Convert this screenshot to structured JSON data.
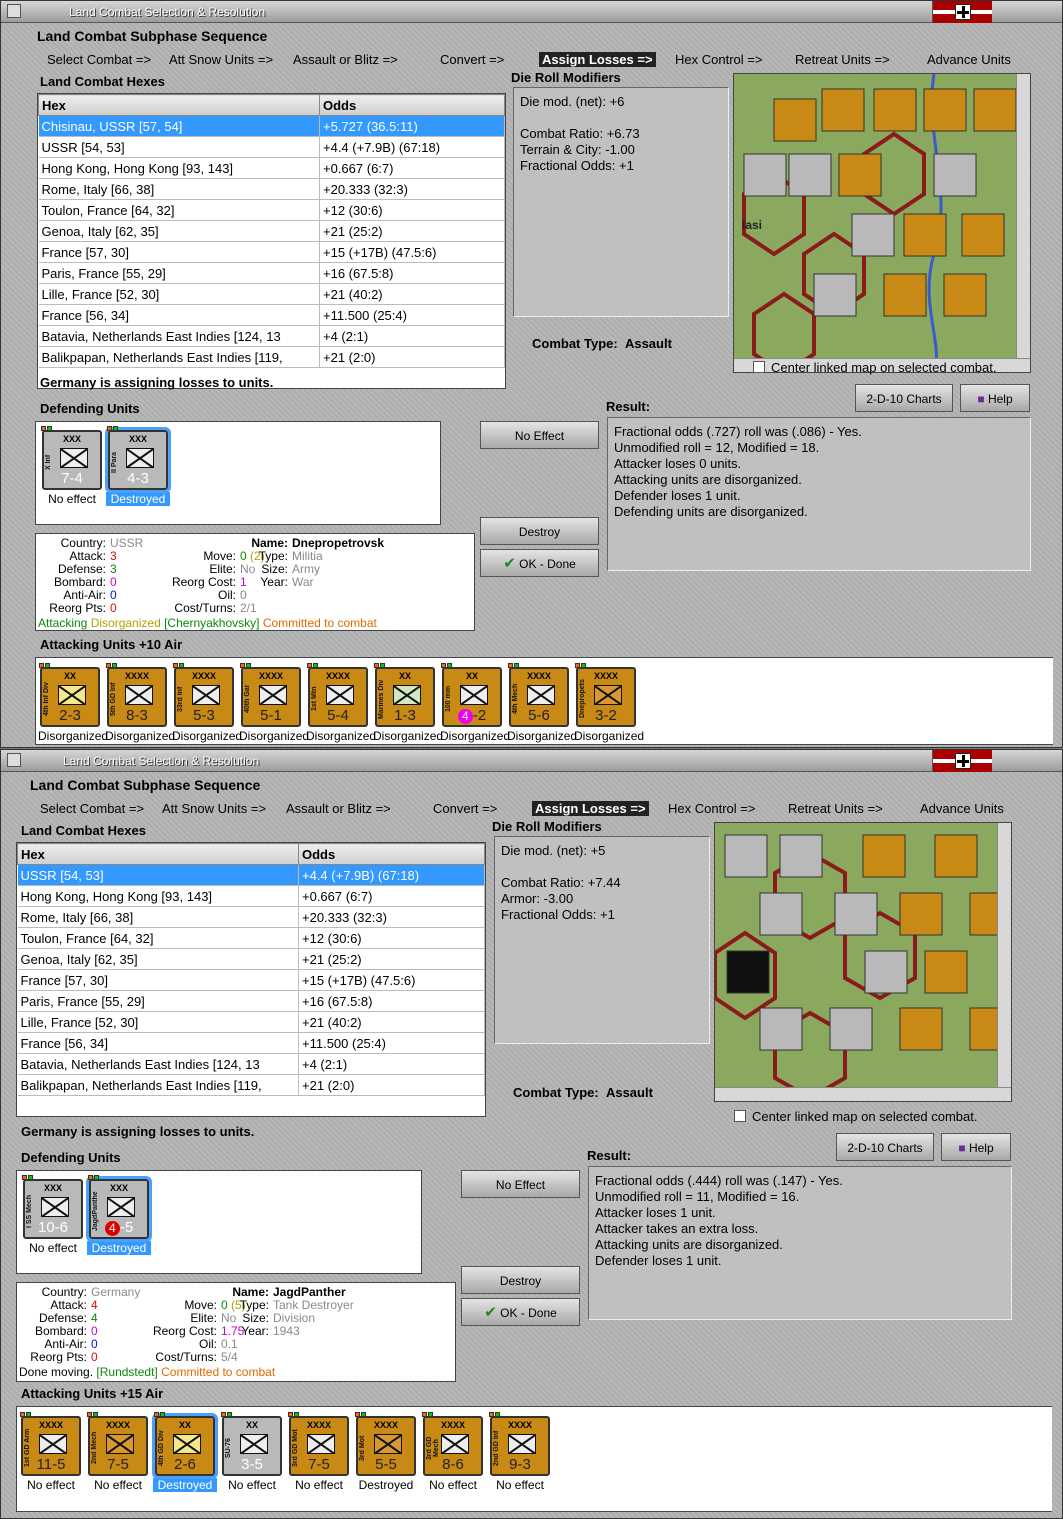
{
  "windows": [
    {
      "title": "Land Combat Selection & Resolution",
      "subphase_title": "Land Combat Subphase Sequence",
      "sequence": [
        "Select Combat =>",
        "Att Snow Units =>",
        "Assault or Blitz =>",
        "Convert =>",
        "Assign Losses =>",
        "Hex Control =>",
        "Retreat Units =>",
        "Advance Units"
      ],
      "hexes_label": "Land Combat Hexes",
      "col_hex": "Hex",
      "col_odds": "Odds",
      "rows": [
        {
          "hex": "Chisinau, USSR [57, 54]",
          "odds": "+5.727 (36.5:11)"
        },
        {
          "hex": "USSR [54, 53]",
          "odds": "+4.4 (+7.9B) (67:18)"
        },
        {
          "hex": "Hong Kong, Hong Kong [93, 143]",
          "odds": "+0.667 (6:7)"
        },
        {
          "hex": "Rome, Italy [66, 38]",
          "odds": "+20.333 (32:3)"
        },
        {
          "hex": "Toulon, France [64, 32]",
          "odds": "+12 (30:6)"
        },
        {
          "hex": "Genoa, Italy [62, 35]",
          "odds": "+21 (25:2)"
        },
        {
          "hex": "France [57, 30]",
          "odds": "+15 (+17B) (47.5:6)"
        },
        {
          "hex": "Paris, France [55, 29]",
          "odds": "+16 (67.5:8)"
        },
        {
          "hex": "Lille, France [52, 30]",
          "odds": "+21 (40:2)"
        },
        {
          "hex": "France [56, 34]",
          "odds": "+11.500 (25:4)"
        },
        {
          "hex": "Batavia, Netherlands East Indies [124, 13",
          "odds": "+4 (2:1)"
        },
        {
          "hex": "Balikpapan, Netherlands East Indies [119,",
          "odds": "+21 (2:0)"
        }
      ],
      "drm_label": "Die Roll Modifiers",
      "drm_lines": [
        "Die mod. (net): +6",
        "",
        "Combat Ratio: +6.73",
        "Terrain & City: -1.00",
        "Fractional Odds: +1"
      ],
      "combat_type_label": "Combat Type:",
      "combat_type": "Assault",
      "center_map": "Center linked map on selected combat.",
      "charts_btn": "2-D-10 Charts",
      "help_btn": "Help",
      "status": "Germany is assigning losses to units.",
      "defending_label": "Defending Units",
      "no_effect_btn": "No Effect",
      "destroy_btn": "Destroy",
      "ok_btn": "OK - Done",
      "result_label": "Result:",
      "result_lines": [
        "Fractional odds (.727) roll was (.086)  - Yes.",
        "Unmodified roll = 12, Modified = 18.",
        "Attacker loses 0 units.",
        "Attacking units are disorganized.",
        "Defender loses 1 unit.",
        "Defending units are disorganized."
      ],
      "defenders": [
        {
          "side": "X Inf",
          "ech": "XXX",
          "str": "7-4",
          "label": "No effect",
          "sel": false
        },
        {
          "side": "II Para",
          "ech": "XXX",
          "str": "4-3",
          "label": "Destroyed",
          "sel": true
        }
      ],
      "info": {
        "country_k": "Country:",
        "country_v": "USSR",
        "attack_k": "Attack:",
        "attack_v": "3",
        "defense_k": "Defense:",
        "defense_v": "3",
        "bombard_k": "Bombard:",
        "bombard_v": "0",
        "antiair_k": "Anti-Air:",
        "antiair_v": "0",
        "reorgpts_k": "Reorg Pts:",
        "reorgpts_v": "0",
        "move_k": "Move:",
        "move_v": "0",
        "move_v2": "(2)",
        "elite_k": "Elite:",
        "elite_v": "No",
        "reorgcost_k": "Reorg Cost:",
        "reorgcost_v": "1",
        "oil_k": "Oil:",
        "oil_v": "0",
        "cost_k": "Cost/Turns:",
        "cost_v": "2/1",
        "name_k": "Name:",
        "name_v": "Dnepropetrovsk",
        "type_k": "Type:",
        "type_v": "Militia",
        "size_k": "Size:",
        "size_v": "Army",
        "year_k": "Year:",
        "year_v": "War",
        "foot_a": "Attacking",
        "foot_b": "Disorganized",
        "foot_c": "[Chernyakhovsky]",
        "foot_d": "Committed to combat"
      },
      "attacking_label": "Attacking Units +10 Air",
      "attackers": [
        {
          "side": "4th Inf Div",
          "ech": "XX",
          "str": "2-3",
          "label": "Disorganized",
          "sym": "yel"
        },
        {
          "side": "5th GD Inf",
          "ech": "XXXX",
          "str": "8-3",
          "label": "Disorganized",
          "sym": ""
        },
        {
          "side": "33rd Inf",
          "ech": "XXXX",
          "str": "5-3",
          "label": "Disorganized",
          "sym": ""
        },
        {
          "side": "40th Gar",
          "ech": "XXXX",
          "str": "5-1",
          "label": "Disorganized",
          "sym": ""
        },
        {
          "side": "1st Mtn",
          "ech": "XXXX",
          "str": "5-4",
          "label": "Disorganized",
          "sym": ""
        },
        {
          "side": "Marines Div",
          "ech": "XX",
          "str": "1-3",
          "label": "Disorganized",
          "sym": "grn"
        },
        {
          "side": "100 mm",
          "ech": "XX",
          "str": "4",
          "str2": "-2",
          "label": "Disorganized",
          "sym": "",
          "badge": "m"
        },
        {
          "side": "4th Mech",
          "ech": "XXXX",
          "str": "5-6",
          "label": "Disorganized",
          "sym": ""
        },
        {
          "side": "Dnepropets",
          "ech": "XXXX",
          "str": "3-2",
          "label": "Disorganized",
          "sym": "gold2"
        }
      ]
    },
    {
      "title": "Land Combat Selection & Resolution",
      "subphase_title": "Land Combat Subphase Sequence",
      "sequence": [
        "Select Combat =>",
        "Att Snow Units =>",
        "Assault or Blitz =>",
        "Convert =>",
        "Assign Losses =>",
        "Hex Control =>",
        "Retreat Units =>",
        "Advance Units"
      ],
      "hexes_label": "Land Combat Hexes",
      "col_hex": "Hex",
      "col_odds": "Odds",
      "rows": [
        {
          "hex": "USSR [54, 53]",
          "odds": "+4.4 (+7.9B) (67:18)"
        },
        {
          "hex": "Hong Kong, Hong Kong [93, 143]",
          "odds": "+0.667 (6:7)"
        },
        {
          "hex": "Rome, Italy [66, 38]",
          "odds": "+20.333 (32:3)"
        },
        {
          "hex": "Toulon, France [64, 32]",
          "odds": "+12 (30:6)"
        },
        {
          "hex": "Genoa, Italy [62, 35]",
          "odds": "+21 (25:2)"
        },
        {
          "hex": "France [57, 30]",
          "odds": "+15 (+17B) (47.5:6)"
        },
        {
          "hex": "Paris, France [55, 29]",
          "odds": "+16 (67.5:8)"
        },
        {
          "hex": "Lille, France [52, 30]",
          "odds": "+21 (40:2)"
        },
        {
          "hex": "France [56, 34]",
          "odds": "+11.500 (25:4)"
        },
        {
          "hex": "Batavia, Netherlands East Indies [124, 13",
          "odds": "+4 (2:1)"
        },
        {
          "hex": "Balikpapan, Netherlands East Indies [119,",
          "odds": "+21 (2:0)"
        }
      ],
      "drm_label": "Die Roll Modifiers",
      "drm_lines": [
        "Die mod. (net): +5",
        "",
        "Combat Ratio: +7.44",
        "Armor: -3.00",
        "Fractional Odds: +1"
      ],
      "combat_type_label": "Combat Type:",
      "combat_type": "Assault",
      "center_map": "Center linked map on selected combat.",
      "charts_btn": "2-D-10 Charts",
      "help_btn": "Help",
      "status": "Germany is assigning losses to units.",
      "defending_label": "Defending Units",
      "no_effect_btn": "No Effect",
      "destroy_btn": "Destroy",
      "ok_btn": "OK - Done",
      "result_label": "Result:",
      "result_lines": [
        "Fractional odds (.444) roll was (.147)  - Yes.",
        "Unmodified roll = 11, Modified = 16.",
        "Attacker loses 1 unit.",
        "Attacker takes an extra loss.",
        "Attacking units are disorganized.",
        "Defender loses 1 unit."
      ],
      "defenders": [
        {
          "side": "I SS Mech",
          "ech": "XXX",
          "str": "10-6",
          "label": "No effect",
          "sel": false
        },
        {
          "side": "JagdPanther",
          "ech": "XXX",
          "str": "4",
          "str2": "-5",
          "label": "Destroyed",
          "sel": true,
          "badge": "r"
        }
      ],
      "info": {
        "country_k": "Country:",
        "country_v": "Germany",
        "attack_k": "Attack:",
        "attack_v": "4",
        "defense_k": "Defense:",
        "defense_v": "4",
        "bombard_k": "Bombard:",
        "bombard_v": "0",
        "antiair_k": "Anti-Air:",
        "antiair_v": "0",
        "reorgpts_k": "Reorg Pts:",
        "reorgpts_v": "0",
        "move_k": "Move:",
        "move_v": "0",
        "move_v2": "(5)",
        "elite_k": "Elite:",
        "elite_v": "No",
        "reorgcost_k": "Reorg Cost:",
        "reorgcost_v": "1.75",
        "oil_k": "Oil:",
        "oil_v": "0.1",
        "cost_k": "Cost/Turns:",
        "cost_v": "5/4",
        "name_k": "Name:",
        "name_v": "JagdPanther",
        "type_k": "Type:",
        "type_v": "Tank Destroyer",
        "size_k": "Size:",
        "size_v": "Division",
        "year_k": "Year:",
        "year_v": "1943",
        "foot_a": "Done moving.",
        "foot_b": "",
        "foot_c": "[Rundstedt]",
        "foot_d": "Committed to combat"
      },
      "attacking_label": "Attacking Units +15 Air",
      "attackers": [
        {
          "side": "1st GD Arm",
          "ech": "XXXX",
          "str": "11-5",
          "label": "No effect",
          "sym": "arm"
        },
        {
          "side": "2nd Mech",
          "ech": "XXXX",
          "str": "7-5",
          "label": "No effect",
          "sym": "gold2"
        },
        {
          "side": "4th GD Div",
          "ech": "XX",
          "str": "2-6",
          "label": "Destroyed",
          "sym": "yel",
          "sel": true
        },
        {
          "side": "SU-76",
          "ech": "XX",
          "str": "3-5",
          "label": "No effect",
          "sym": "",
          "grey": true
        },
        {
          "side": "3rd GD Mot",
          "ech": "XXXX",
          "str": "7-5",
          "label": "No effect",
          "sym": ""
        },
        {
          "side": "3rd Mot",
          "ech": "XXXX",
          "str": "5-5",
          "label": "Destroyed",
          "sym": "gold2"
        },
        {
          "side": "3rd GD Mech",
          "ech": "XXXX",
          "str": "8-6",
          "label": "No effect",
          "sym": ""
        },
        {
          "side": "2nd GD Inf",
          "ech": "XXXX",
          "str": "9-3",
          "label": "No effect",
          "sym": ""
        }
      ]
    }
  ]
}
